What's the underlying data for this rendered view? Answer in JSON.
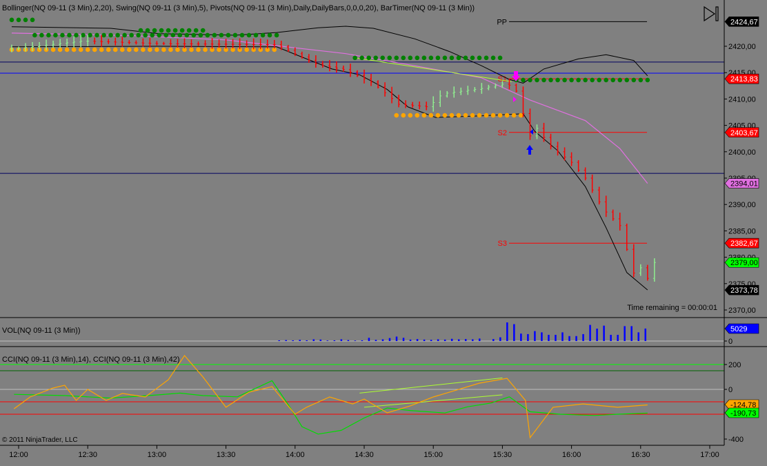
{
  "header": {
    "price_panel_title": "Bollinger(NQ 09-11 (3 Min),2,20), Swing(NQ 09-11 (3 Min),5), Pivots(NQ 09-11 (3 Min),Daily,DailyBars,0,0,0,20), BarTimer(NQ 09-11 (3 Min))",
    "volume_panel_title": "VOL(NQ 09-11 (3 Min))",
    "cci_panel_title": "CCI(NQ 09-11 (3 Min),14), CCI(NQ 09-11 (3 Min),42)",
    "copyright": "© 2011 NinjaTrader, LLC",
    "time_remaining": "Time remaining = 00:00:01"
  },
  "colors": {
    "background": "#808080",
    "up": "#90ee90",
    "down": "#ff0000",
    "bollinger": "#000000",
    "sma": "#e070e0",
    "swing_high": "#008000",
    "swing_low": "#ffa500",
    "pivot_pp": "#000000",
    "pivot_s": "#ff0000",
    "cci14": "#ffa500",
    "cci42": "#00dd00",
    "volume": "#0000ff"
  },
  "pivots": [
    {
      "label": "PP",
      "price": 2424.67,
      "tag": "2424,67",
      "color": "#000000",
      "tagbg": "#000000",
      "tagfg": "#ffffff"
    },
    {
      "label": "S1",
      "price": 2413.83,
      "tag": "2413,83",
      "color": "#ff0000",
      "tagbg": "#ff0000",
      "tagfg": "#ffffff"
    },
    {
      "label": "S2",
      "price": 2403.67,
      "tag": "2403,67",
      "color": "#ff0000",
      "tagbg": "#ff0000",
      "tagfg": "#ffffff"
    },
    {
      "label": "S3",
      "price": 2382.67,
      "tag": "2382,67",
      "color": "#ff0000",
      "tagbg": "#ff0000",
      "tagfg": "#ffffff"
    }
  ],
  "price_tags": [
    {
      "price": 2394.01,
      "tag": "2394,01",
      "tagbg": "#e070e0",
      "tagfg": "#000000"
    },
    {
      "price": 2379.0,
      "tag": "2379,00",
      "tagbg": "#00ff00",
      "tagfg": "#000000"
    },
    {
      "price": 2373.78,
      "tag": "2373,78",
      "tagbg": "#000000",
      "tagfg": "#ffffff"
    }
  ],
  "price_axis": {
    "ticks": [
      "2370,00",
      "2375,00",
      "2380,00",
      "2385,00",
      "2390,00",
      "2395,00",
      "2400,00",
      "2405,00",
      "2410,00",
      "2415,00",
      "2420,00"
    ],
    "tick_values": [
      2370,
      2375,
      2380,
      2385,
      2390,
      2395,
      2400,
      2405,
      2410,
      2415,
      2420
    ]
  },
  "time_axis": {
    "ticks": [
      "12:00",
      "12:30",
      "13:00",
      "13:30",
      "14:00",
      "14:30",
      "15:00",
      "15:30",
      "16:00",
      "16:30",
      "17:00"
    ]
  },
  "chart_data": {
    "type": "candlestick",
    "instrument": "NQ 09-11 (3 Min)",
    "bar_minutes": 3,
    "price_path": [
      [
        -3,
        2419.5
      ],
      [
        28,
        2421
      ],
      [
        61,
        2420.5
      ],
      [
        112,
        2420.3
      ],
      [
        118,
        2419
      ],
      [
        130,
        2416.5
      ],
      [
        142,
        2415.5
      ],
      [
        154,
        2413
      ],
      [
        165,
        2409
      ],
      [
        178,
        2408.5
      ],
      [
        184,
        2411
      ],
      [
        201,
        2412
      ],
      [
        212,
        2413
      ],
      [
        216,
        2411.5
      ],
      [
        222,
        2403
      ],
      [
        224,
        2405
      ],
      [
        231,
        2401
      ],
      [
        240,
        2398
      ],
      [
        246,
        2395
      ],
      [
        254,
        2389
      ],
      [
        261,
        2386
      ],
      [
        267,
        2377
      ],
      [
        270,
        2378
      ],
      [
        273,
        2376
      ],
      [
        276,
        2379
      ]
    ],
    "bollinger_upper": [
      [
        -3,
        2423.7
      ],
      [
        40,
        2423.4
      ],
      [
        61,
        2422.4
      ],
      [
        94,
        2422.1
      ],
      [
        112,
        2422.6
      ],
      [
        130,
        2423.5
      ],
      [
        142,
        2423.8
      ],
      [
        154,
        2423.4
      ],
      [
        172,
        2421.4
      ],
      [
        187,
        2419
      ],
      [
        201,
        2416.3
      ],
      [
        213,
        2413.7
      ],
      [
        219,
        2413
      ],
      [
        228,
        2415.7
      ],
      [
        243,
        2417.6
      ],
      [
        255,
        2418.4
      ],
      [
        267,
        2417.3
      ],
      [
        273,
        2414.4
      ]
    ],
    "bollinger_lower": [
      [
        -3,
        2419.9
      ],
      [
        61,
        2420
      ],
      [
        112,
        2419.9
      ],
      [
        121,
        2418.3
      ],
      [
        136,
        2415.7
      ],
      [
        148,
        2414.6
      ],
      [
        160,
        2411.8
      ],
      [
        169,
        2408.5
      ],
      [
        181,
        2406.5
      ],
      [
        201,
        2406.8
      ],
      [
        219,
        2407.2
      ],
      [
        224,
        2403.9
      ],
      [
        234,
        2400.2
      ],
      [
        246,
        2393.4
      ],
      [
        255,
        2385.6
      ],
      [
        264,
        2377.1
      ],
      [
        273,
        2373.8
      ]
    ],
    "sma": [
      [
        -3,
        2422.5
      ],
      [
        50,
        2422
      ],
      [
        90,
        2421.2
      ],
      [
        112,
        2420.1
      ],
      [
        142,
        2418.6
      ],
      [
        172,
        2416.3
      ],
      [
        201,
        2414
      ],
      [
        222,
        2409.8
      ],
      [
        246,
        2405.9
      ],
      [
        261,
        2400.6
      ],
      [
        273,
        2394
      ]
    ],
    "swing_high_dots": [
      [
        -3,
        7,
        2425.0
      ],
      [
        7,
        112,
        2422.1
      ],
      [
        53,
        80,
        2423.0
      ],
      [
        146,
        211,
        2417.8
      ],
      [
        216,
        273,
        2413.6
      ]
    ],
    "swing_low_dots": [
      [
        -3,
        113,
        2419.35
      ],
      [
        164,
        220,
        2406.9
      ]
    ],
    "horizontal_lines": [
      {
        "price": 2417.0,
        "color": "#000060"
      },
      {
        "price": 2414.9,
        "color": "#0000ff"
      },
      {
        "price": 2395.9,
        "color": "#000060"
      }
    ],
    "trendline": [
      [
        146,
        2417.8
      ],
      [
        214,
        2413.3
      ]
    ],
    "volume": {
      "start_min": 113,
      "last_tag": "5029",
      "values": [
        300,
        400,
        300,
        500,
        300,
        700,
        600,
        200,
        300,
        700,
        400,
        200,
        300,
        1300,
        500,
        700,
        1200,
        1800,
        1300,
        600,
        800,
        600,
        500,
        700,
        600,
        900,
        700,
        800,
        700,
        1000,
        0,
        800,
        1500,
        7500,
        6800,
        3000,
        2800,
        4000,
        3500,
        2500,
        2500,
        3500,
        2000,
        2000,
        2800,
        6500,
        5000,
        6200,
        2500,
        2500,
        6000,
        6000,
        3500,
        5029
      ],
      "axis_ticks": [
        "0"
      ]
    },
    "cci": {
      "axis_ticks": [
        "200",
        "0",
        "-400"
      ],
      "axis_values": [
        200,
        0,
        -400
      ],
      "levels": [
        {
          "v": 200,
          "color": "#00ff00"
        },
        {
          "v": 150,
          "color": "#006400"
        },
        {
          "v": 0,
          "color": "#c0c0c0"
        },
        {
          "v": -100,
          "color": "#ff0000"
        },
        {
          "v": -200,
          "color": "#ff0000"
        }
      ],
      "cci14": {
        "tag": "-124,78",
        "points": [
          [
            -2,
            -156
          ],
          [
            5,
            -61
          ],
          [
            15,
            11
          ],
          [
            20,
            33
          ],
          [
            25,
            -89
          ],
          [
            30,
            0
          ],
          [
            38,
            -89
          ],
          [
            45,
            -33
          ],
          [
            55,
            -61
          ],
          [
            65,
            78
          ],
          [
            72,
            272
          ],
          [
            80,
            100
          ],
          [
            90,
            -144
          ],
          [
            100,
            -22
          ],
          [
            110,
            22
          ],
          [
            120,
            -200
          ],
          [
            125,
            -144
          ],
          [
            135,
            -61
          ],
          [
            145,
            -117
          ],
          [
            150,
            -78
          ],
          [
            160,
            -189
          ],
          [
            170,
            -133
          ],
          [
            180,
            -61
          ],
          [
            190,
            -6
          ],
          [
            200,
            50
          ],
          [
            212,
            89
          ],
          [
            220,
            -89
          ],
          [
            222,
            -389
          ],
          [
            232,
            -144
          ],
          [
            245,
            -117
          ],
          [
            260,
            -144
          ],
          [
            273,
            -125
          ]
        ]
      },
      "cci42": {
        "tag": "-190,73",
        "points": [
          [
            -2,
            -40
          ],
          [
            20,
            -50
          ],
          [
            40,
            -70
          ],
          [
            60,
            -45
          ],
          [
            70,
            -30
          ],
          [
            80,
            -50
          ],
          [
            95,
            -60
          ],
          [
            110,
            70
          ],
          [
            118,
            -150
          ],
          [
            123,
            -300
          ],
          [
            130,
            -360
          ],
          [
            140,
            -330
          ],
          [
            150,
            -230
          ],
          [
            160,
            -150
          ],
          [
            170,
            -170
          ],
          [
            185,
            -190
          ],
          [
            195,
            -140
          ],
          [
            205,
            -110
          ],
          [
            213,
            -60
          ],
          [
            222,
            -180
          ],
          [
            235,
            -200
          ],
          [
            250,
            -210
          ],
          [
            260,
            -200
          ],
          [
            273,
            -191
          ]
        ]
      },
      "trendlines": [
        [
          [
            148,
            -30
          ],
          [
            210,
            92
          ]
        ],
        [
          [
            150,
            -144
          ],
          [
            210,
            -44
          ]
        ]
      ]
    }
  }
}
